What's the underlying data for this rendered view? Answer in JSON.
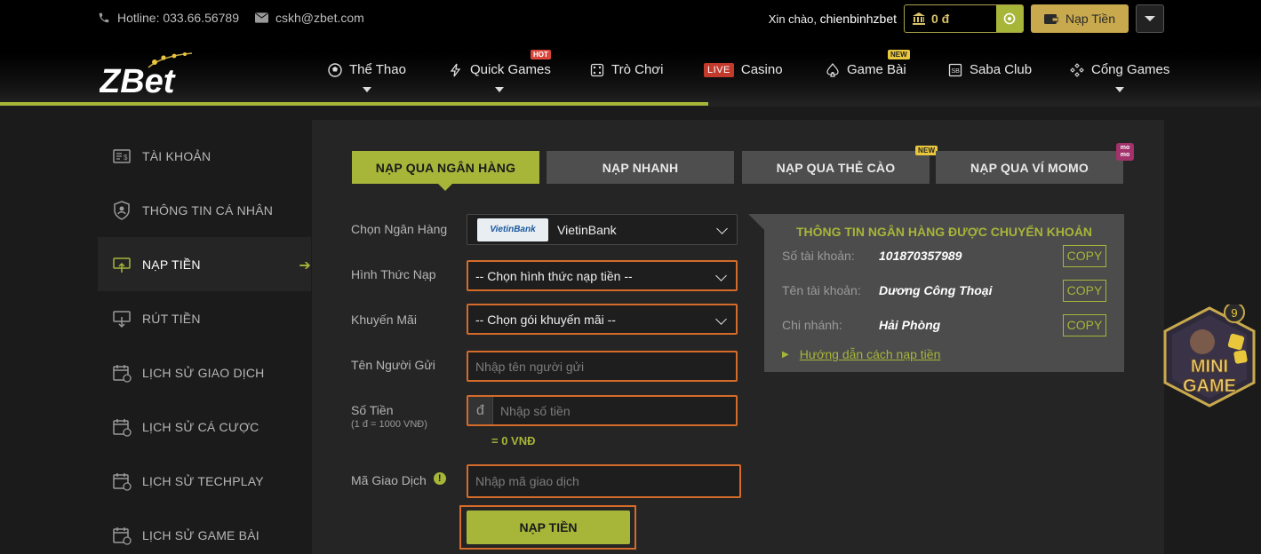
{
  "topbar": {
    "hotline": "Hotline: 033.66.56789",
    "email": "cskh@zbet.com",
    "greeting": "Xin chào,",
    "username": "chienbinhzbet",
    "balance": "0 đ",
    "deposit_label": "Nạp Tiền"
  },
  "brand": {
    "logo_text": "ZBet",
    "accent": "#a7b539",
    "gold": "#c9a94d",
    "highlight": "#d56b2a"
  },
  "nav": [
    {
      "label": "Thể Thao",
      "icon": "soccer-ball-icon"
    },
    {
      "label": "Quick Games",
      "icon": "lightning-icon",
      "badge": "HOT"
    },
    {
      "label": "Trò Chơi",
      "icon": "dice-icon"
    },
    {
      "label": "Casino",
      "badge_inline": "LIVE"
    },
    {
      "label": "Game Bài",
      "icon": "spade-icon",
      "badge": "NEW"
    },
    {
      "label": "Saba Club",
      "icon": "sb-icon"
    },
    {
      "label": "Cổng Games",
      "icon": "gamepad-icon"
    }
  ],
  "sidebar": {
    "items": [
      {
        "label": "TÀI KHOẢN",
        "icon": "account-card-icon"
      },
      {
        "label": "THÔNG TIN CÁ NHÂN",
        "icon": "profile-shield-icon"
      },
      {
        "label": "NẠP TIỀN",
        "icon": "deposit-icon",
        "active": true
      },
      {
        "label": "RÚT TIỀN",
        "icon": "withdraw-icon"
      },
      {
        "label": "LỊCH SỬ GIAO DỊCH",
        "icon": "calendar-icon"
      },
      {
        "label": "LỊCH SỬ CÁ CƯỢC",
        "icon": "calendar-icon"
      },
      {
        "label": "LỊCH SỬ TECHPLAY",
        "icon": "calendar-icon"
      },
      {
        "label": "LỊCH SỬ GAME BÀI",
        "icon": "calendar-icon"
      }
    ]
  },
  "tabs": [
    {
      "label": "NẠP QUA NGÂN HÀNG",
      "active": true
    },
    {
      "label": "NẠP NHANH"
    },
    {
      "label": "NẠP QUA THẺ CÀO",
      "badge": "NEW"
    },
    {
      "label": "NẠP QUA VÍ MOMO",
      "badge": "mo mo"
    }
  ],
  "form": {
    "bank_label": "Chọn Ngân Hàng",
    "bank_logo": "VietinBank",
    "bank_value": "VietinBank",
    "method_label": "Hình Thức Nạp",
    "method_value": "-- Chọn hình thức nạp tiền --",
    "promo_label": "Khuyến Mãi",
    "promo_value": "-- Chọn gói khuyến mãi --",
    "sender_label": "Tên Người Gửi",
    "sender_placeholder": "Nhập tên người gửi",
    "amount_label": "Số Tiền",
    "amount_note": "(1 đ = 1000 VNĐ)",
    "currency_symbol": "đ",
    "amount_placeholder": "Nhập số tiền",
    "converted": "= 0 VNĐ",
    "txn_label": "Mã Giao Dịch",
    "txn_placeholder": "Nhập mã giao dịch",
    "submit_label": "NẠP TIỀN"
  },
  "bank_info": {
    "title": "THÔNG TIN NGÂN HÀNG ĐƯỢC CHUYỂN KHOẢN",
    "rows": [
      {
        "key": "Số tài khoản:",
        "value": "101870357989",
        "copy": "COPY"
      },
      {
        "key": "Tên tài khoản:",
        "value": "Dương Công Thoại",
        "copy": "COPY"
      },
      {
        "key": "Chi nhánh:",
        "value": "Hải Phòng",
        "copy": "COPY"
      }
    ],
    "guide": "Hướng dẫn cách nạp tiền"
  },
  "mini_game": {
    "label_line1": "MINI",
    "label_line2": "GAME",
    "count": "9"
  }
}
